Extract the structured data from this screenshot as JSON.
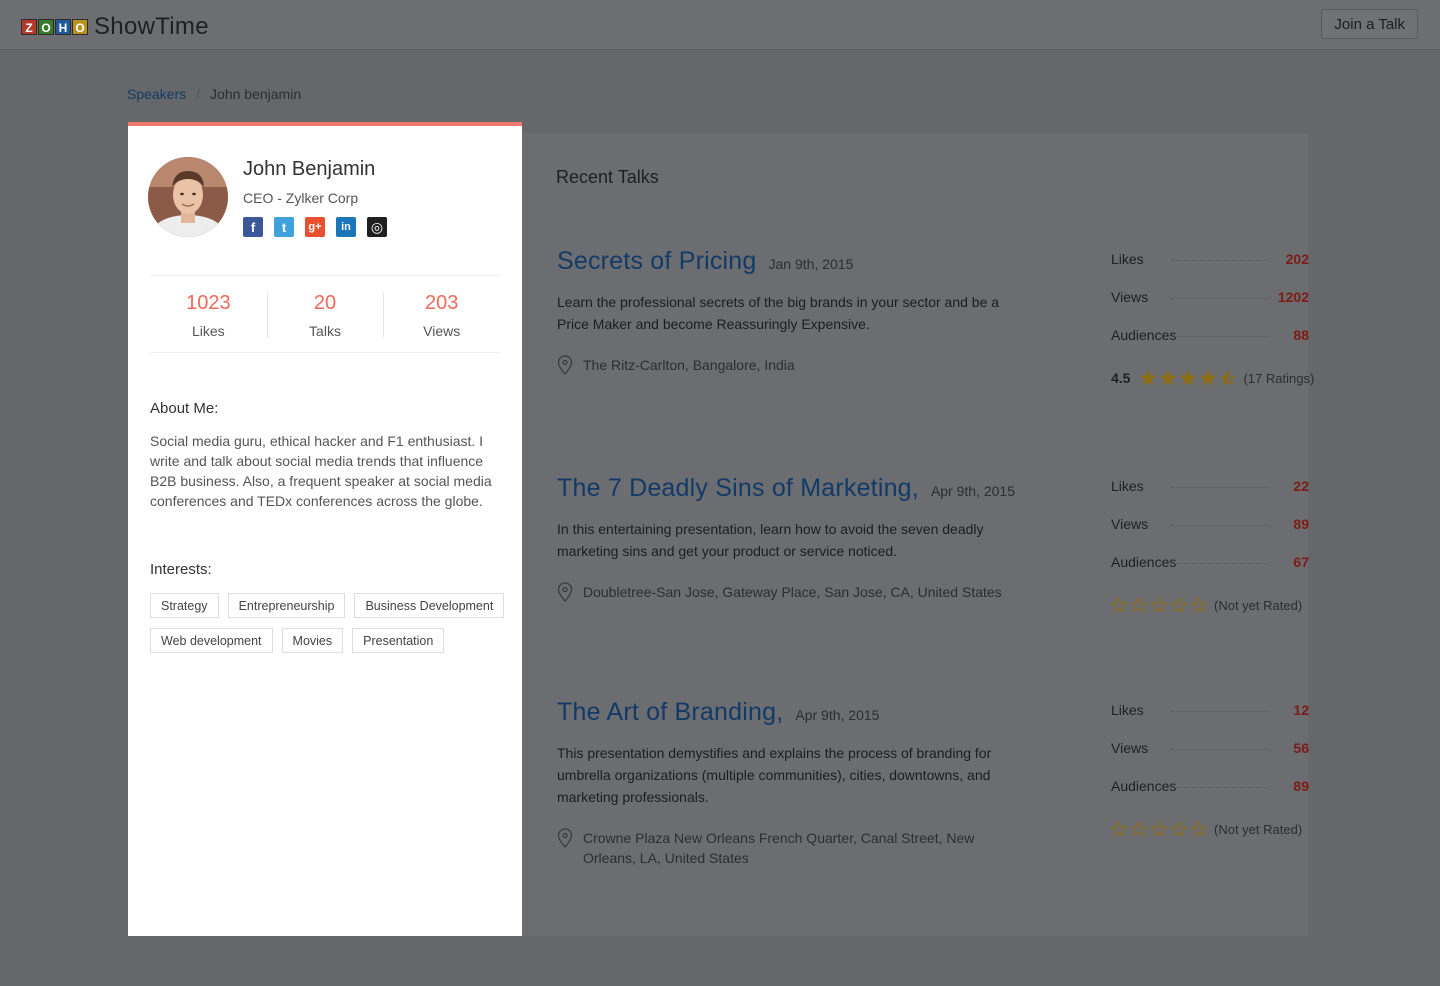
{
  "header": {
    "logo_letters": [
      "Z",
      "O",
      "H",
      "O"
    ],
    "logo_colors": [
      "#b3392b",
      "#3a7a2e",
      "#1f5a9a",
      "#b8921c"
    ],
    "app_name": "ShowTime",
    "join_label": "Join a Talk"
  },
  "breadcrumb": {
    "root": "Speakers",
    "separator": "/",
    "current": "John benjamin"
  },
  "profile": {
    "name": "John Benjamin",
    "role": "CEO - Zylker Corp",
    "socials": [
      {
        "icon": "facebook-icon",
        "glyph": "f",
        "color": "#3b5998"
      },
      {
        "icon": "twitter-icon",
        "glyph": "t",
        "color": "#3fa2dd"
      },
      {
        "icon": "google-plus-icon",
        "glyph": "g+",
        "color": "#e8502f"
      },
      {
        "icon": "linkedin-icon",
        "glyph": "in",
        "color": "#1b75b9"
      },
      {
        "icon": "website-icon",
        "glyph": "◎",
        "color": "#1f1f1f"
      }
    ],
    "stats": [
      {
        "value": "1023",
        "label": "Likes"
      },
      {
        "value": "20",
        "label": "Talks"
      },
      {
        "value": "203",
        "label": "Views"
      }
    ],
    "about_title": "About Me:",
    "about_text": "Social media guru, ethical hacker and F1 enthusiast. I write and talk about social media trends that influence B2B business. Also, a frequent speaker at social media conferences and TEDx conferences across the globe.",
    "interests_title": "Interests:",
    "interests": [
      "Strategy",
      "Entrepreneurship",
      "Business Development",
      "Web development",
      "Movies",
      "Presentation"
    ]
  },
  "talks_panel": {
    "title": "Recent Talks",
    "likes_label": "Likes",
    "views_label": "Views",
    "audiences_label": "Audiences",
    "talks": [
      {
        "title": "Secrets of Pricing",
        "date": "Jan 9th, 2015",
        "description": "Learn the professional secrets of the big brands in your sector and be a Price Maker and become Reassuringly Expensive.",
        "location": "The Ritz-Carlton, Bangalore, India",
        "likes": "202",
        "views": "1202",
        "audiences": "88",
        "rating_value": "4.5",
        "stars_filled": 4.5,
        "rating_text": "(17 Ratings)"
      },
      {
        "title": "The 7 Deadly Sins of Marketing,",
        "date": "Apr 9th, 2015",
        "description": "In this entertaining presentation, learn how to avoid the seven deadly marketing sins and get your product or service noticed.",
        "location": "Doubletree-San Jose, Gateway Place, San Jose, CA, United States",
        "likes": "22",
        "views": "89",
        "audiences": "67",
        "rating_value": "",
        "stars_filled": 0,
        "rating_text": "(Not yet Rated)"
      },
      {
        "title": "The Art of Branding,",
        "date": "Apr 9th, 2015",
        "description": "This presentation demystifies and explains the process of branding for umbrella organizations (multiple communities), cities, downtowns, and marketing professionals.",
        "location": "Crowne Plaza New Orleans French Quarter, Canal Street, New Orleans, LA, United States",
        "likes": "12",
        "views": "56",
        "audiences": "89",
        "rating_value": "",
        "stars_filled": 0,
        "rating_text": "(Not yet Rated)"
      }
    ]
  },
  "colors": {
    "accent": "#f0796d",
    "stat_value": "#f0695a",
    "link": "#123a66",
    "star": "#8a6d16"
  }
}
